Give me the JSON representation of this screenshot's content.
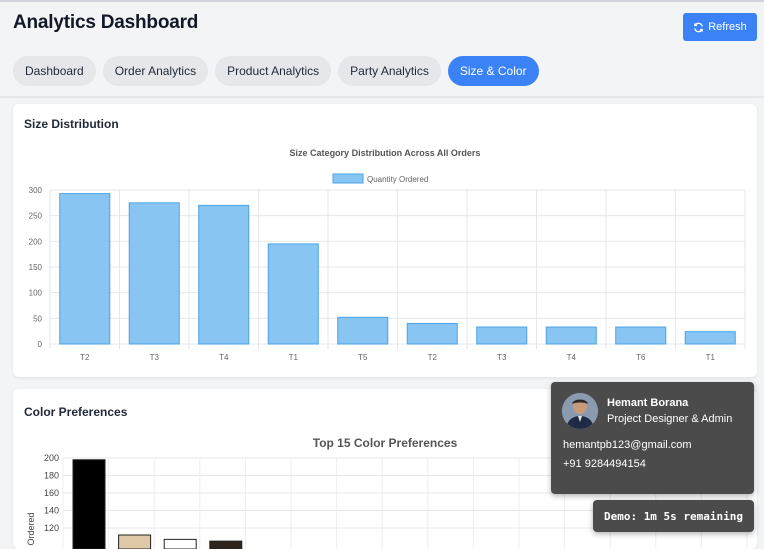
{
  "header": {
    "title": "Analytics Dashboard",
    "refresh_label": "Refresh"
  },
  "tabs": [
    {
      "label": "Dashboard"
    },
    {
      "label": "Order Analytics"
    },
    {
      "label": "Product Analytics"
    },
    {
      "label": "Party Analytics"
    },
    {
      "label": "Size & Color",
      "active": true
    }
  ],
  "colors": {
    "accent": "#3b82f6",
    "bar_fill": "#89c5f3",
    "bar_stroke": "#4aa3e8"
  },
  "size_card": {
    "title": "Size Distribution"
  },
  "color_card": {
    "title": "Color Preferences"
  },
  "chart_data": [
    {
      "type": "bar",
      "title": "Size Category Distribution Across All Orders",
      "legend": "top",
      "series": [
        {
          "name": "Quantity Ordered",
          "values": [
            293,
            275,
            270,
            195,
            52,
            40,
            33,
            33,
            33,
            24
          ]
        }
      ],
      "categories": [
        "T2",
        "T3",
        "T4",
        "T1",
        "T5",
        "T2",
        "T3",
        "T4",
        "T6",
        "T1"
      ],
      "ylim": [
        0,
        300
      ],
      "yticks": [
        0,
        50,
        100,
        150,
        200,
        250,
        300
      ],
      "grid": true
    },
    {
      "type": "bar",
      "title": "Top 15 Color Preferences",
      "ylabel": "Ordered",
      "yticks": [
        120,
        140,
        160,
        180,
        200
      ],
      "ylim": [
        0,
        200
      ],
      "grid": true,
      "values": [
        198,
        112,
        107,
        105
      ],
      "bar_colors": [
        "#000000",
        "#dfc8a8",
        "#ffffff",
        "#2f241b"
      ]
    }
  ],
  "profile": {
    "name": "Hemant Borana",
    "role": "Project Designer & Admin",
    "email": "hemantpb123@gmail.com",
    "phone": "+91 9284494154"
  },
  "demo": {
    "text": "Demo: 1m 5s remaining"
  }
}
